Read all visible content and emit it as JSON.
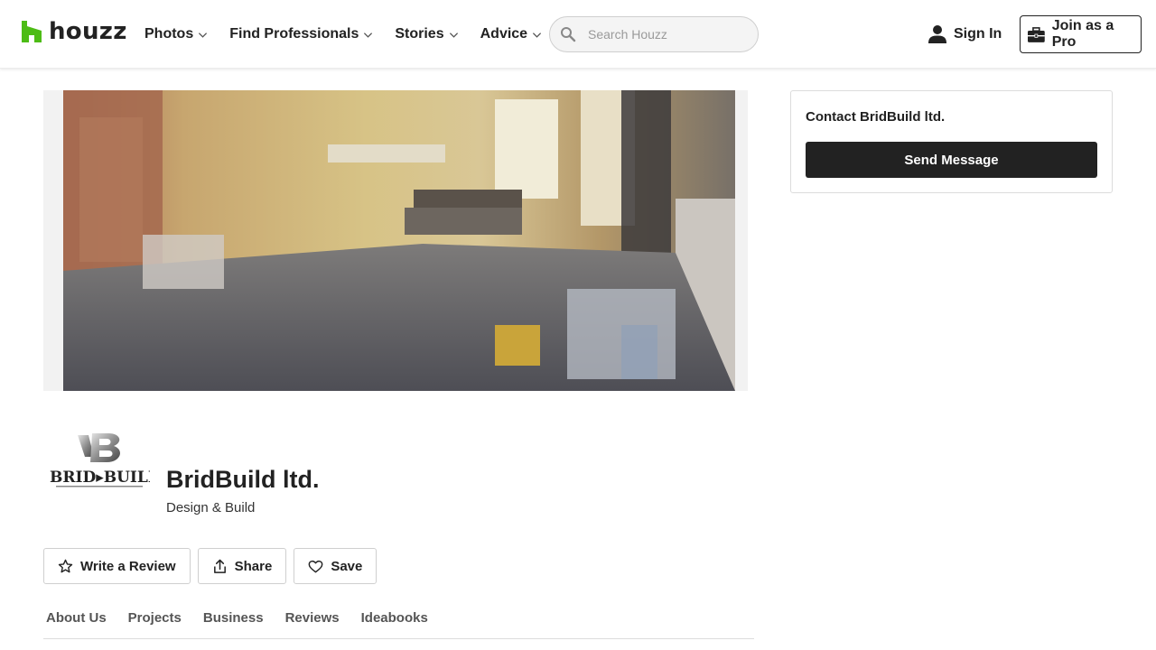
{
  "header": {
    "brand": "houzz",
    "nav": [
      {
        "label": "Photos"
      },
      {
        "label": "Find Professionals"
      },
      {
        "label": "Stories"
      },
      {
        "label": "Advice"
      }
    ],
    "search": {
      "placeholder": "Search Houzz",
      "value": ""
    },
    "sign_in": "Sign In",
    "join_pro": "Join as a Pro"
  },
  "contact": {
    "title": "Contact BridBuild ltd.",
    "send_button": "Send Message"
  },
  "profile": {
    "name": "BridBuild ltd.",
    "category": "Design & Build",
    "logo_text": "BRID▸BUILD"
  },
  "actions": [
    {
      "label": "Write a Review",
      "icon": "star-icon"
    },
    {
      "label": "Share",
      "icon": "share-icon"
    },
    {
      "label": "Save",
      "icon": "heart-icon"
    }
  ],
  "tabs": [
    {
      "label": "About Us"
    },
    {
      "label": "Projects"
    },
    {
      "label": "Business"
    },
    {
      "label": "Reviews"
    },
    {
      "label": "Ideabooks"
    }
  ],
  "colors": {
    "brand_green": "#4dbc15",
    "primary_dark": "#222222",
    "border": "#dcdcdc"
  }
}
